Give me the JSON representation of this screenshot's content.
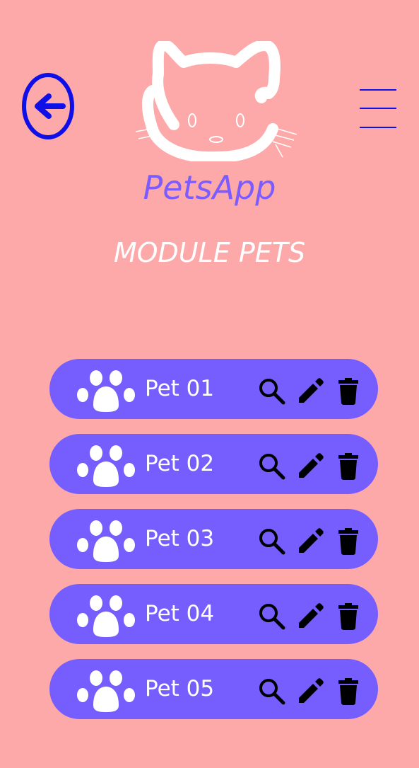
{
  "header": {
    "app_name": "PetsApp",
    "module_title": "MODULE PETS",
    "accent_color": "#0F0FE8",
    "brand_color": "#765EFE",
    "background_color": "#FDA9A9"
  },
  "pets": [
    {
      "name": "Pet 01"
    },
    {
      "name": "Pet 02"
    },
    {
      "name": "Pet 03"
    },
    {
      "name": "Pet 04"
    },
    {
      "name": "Pet 05"
    }
  ],
  "icons": {
    "back": "arrow-left-circle-icon",
    "menu": "hamburger-menu-icon",
    "logo": "cat-face-icon",
    "pet": "paw-icon",
    "search": "search-icon",
    "edit": "pencil-icon",
    "delete": "trash-icon"
  }
}
